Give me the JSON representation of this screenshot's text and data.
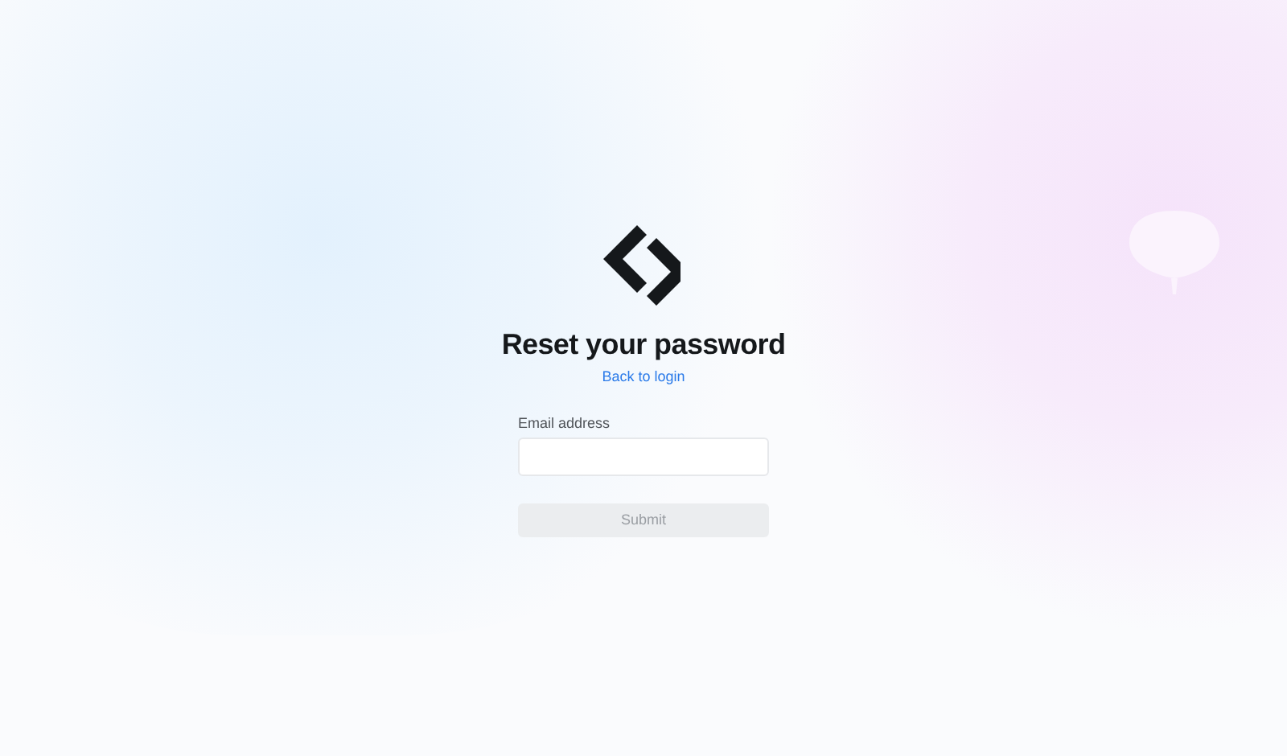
{
  "title": "Reset your password",
  "back_link": "Back to login",
  "email_field": {
    "label": "Email address"
  },
  "submit": {
    "label": "Submit",
    "disabled": true
  }
}
